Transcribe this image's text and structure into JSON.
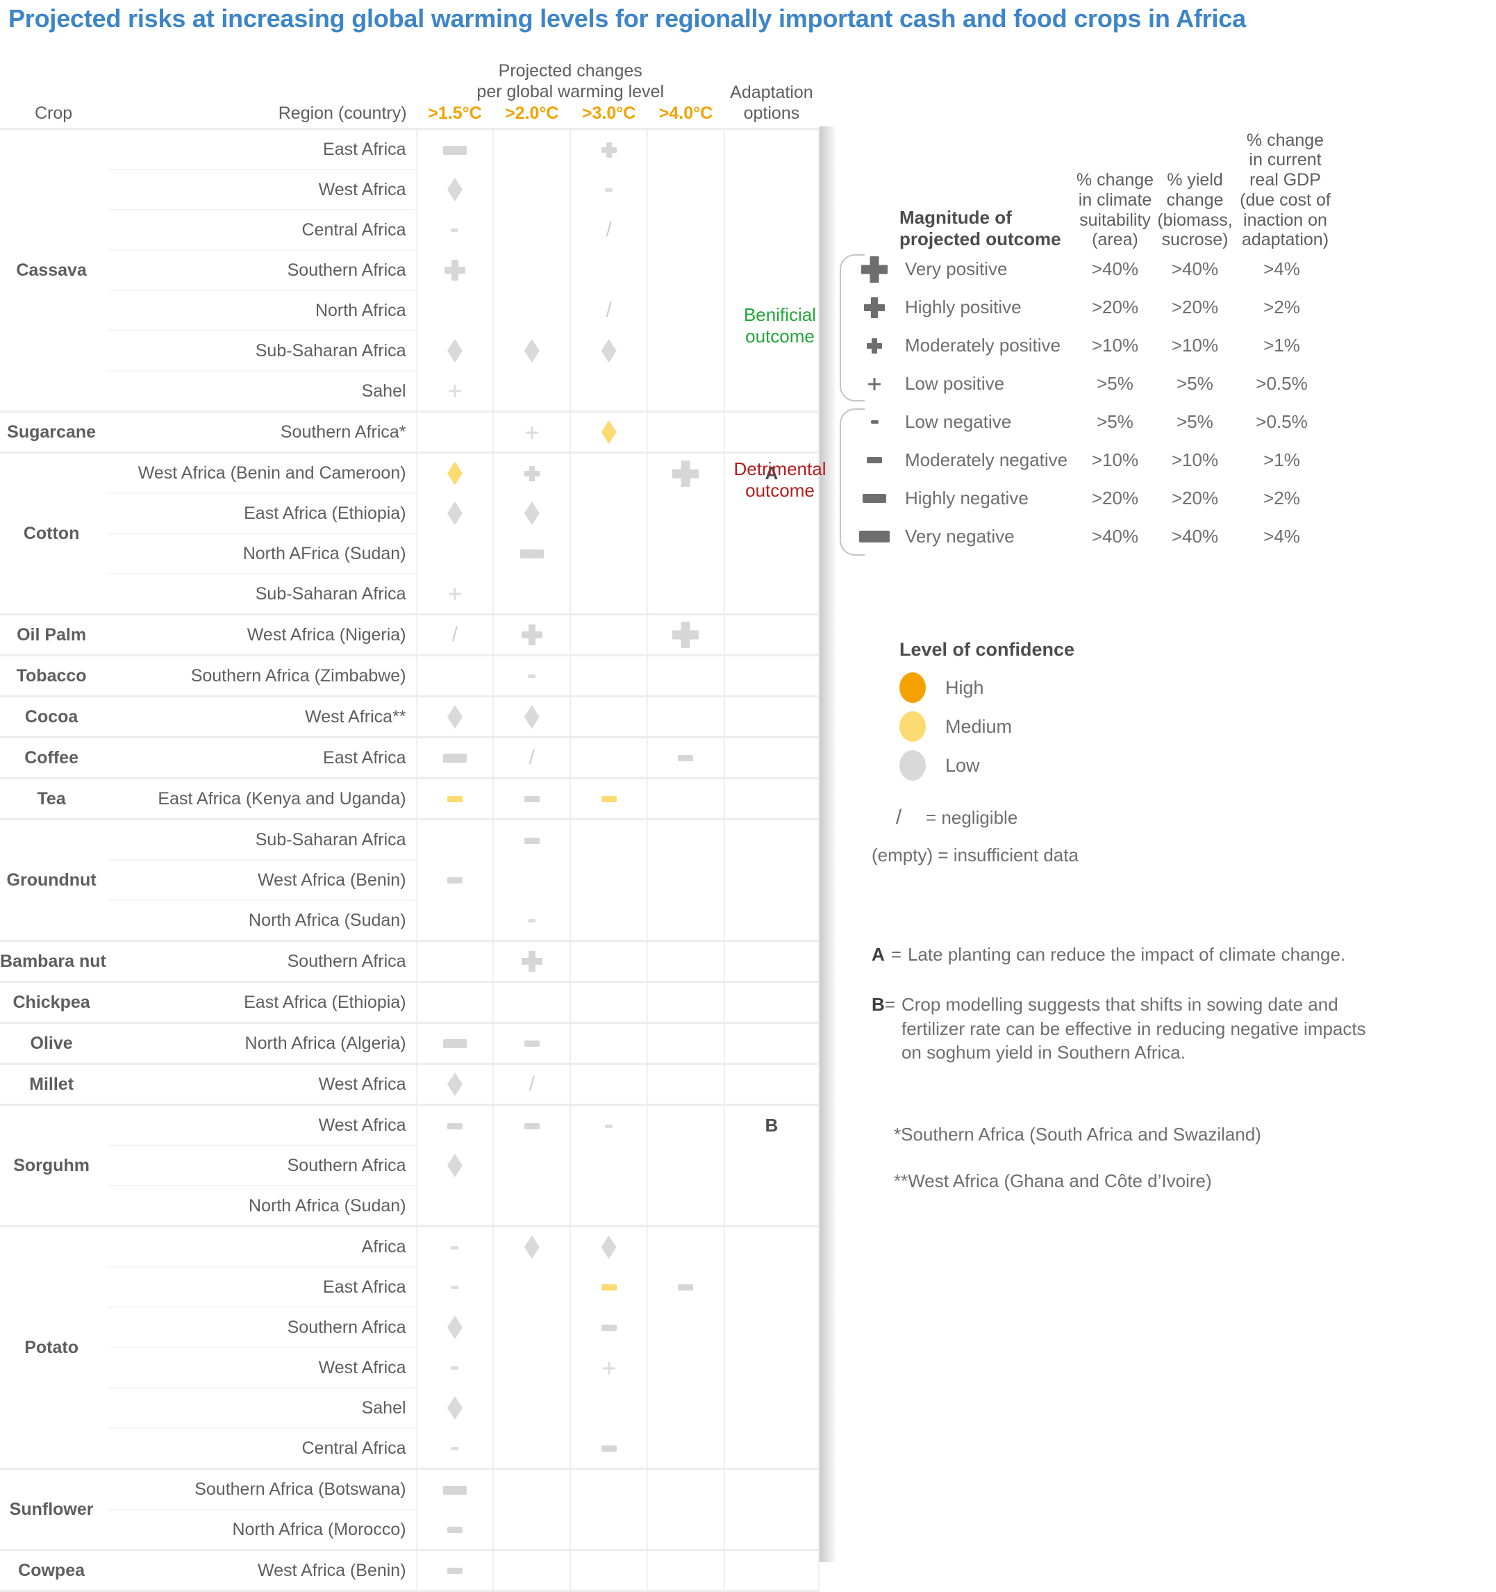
{
  "title": "Projected risks at increasing global warming levels for regionally important cash and food crops in Africa",
  "table": {
    "span_header_line1": "Projected changes",
    "span_header_line2": "per global warming level",
    "headers": {
      "crop": "Crop",
      "region": "Region (country)",
      "gwl": [
        "&gt;1.5°C",
        "&gt;2.0°C",
        "&gt;3.0°C",
        "&gt;4.0°C"
      ],
      "adaptation_line1": "Adaptation",
      "adaptation_line2": "options"
    },
    "groups": [
      {
        "crop": "Cassava",
        "rows": [
          {
            "region": "East Africa",
            "cells": [
              "highly-negative",
              "",
              "moderately-positive",
              ""
            ],
            "conf": [
              "low",
              "",
              "low",
              ""
            ],
            "adapt": ""
          },
          {
            "region": "West Africa",
            "cells": [
              "diamond",
              "",
              "low-negative",
              ""
            ],
            "conf": [
              "low",
              "",
              "low",
              ""
            ],
            "adapt": ""
          },
          {
            "region": "Central Africa",
            "cells": [
              "low-negative",
              "",
              "negligible",
              ""
            ],
            "conf": [
              "low",
              "",
              "low",
              ""
            ],
            "adapt": ""
          },
          {
            "region": "Southern Africa",
            "cells": [
              "highly-positive",
              "",
              "",
              ""
            ],
            "conf": [
              "low",
              "",
              "",
              ""
            ],
            "adapt": ""
          },
          {
            "region": "North Africa",
            "cells": [
              "",
              "",
              "negligible",
              ""
            ],
            "conf": [
              "",
              "",
              "low",
              ""
            ],
            "adapt": ""
          },
          {
            "region": "Sub-Saharan Africa",
            "cells": [
              "diamond",
              "diamond",
              "diamond",
              ""
            ],
            "conf": [
              "low",
              "low",
              "low",
              ""
            ],
            "adapt": ""
          },
          {
            "region": "Sahel",
            "cells": [
              "low-positive",
              "",
              "",
              ""
            ],
            "conf": [
              "low",
              "",
              "",
              ""
            ],
            "adapt": ""
          }
        ]
      },
      {
        "crop": "Sugarcane",
        "rows": [
          {
            "region": "Southern Africa*",
            "cells": [
              "",
              "low-positive",
              "diamond",
              ""
            ],
            "conf": [
              "",
              "low",
              "medium",
              ""
            ],
            "adapt": ""
          }
        ]
      },
      {
        "crop": "Cotton",
        "rows": [
          {
            "region": "West Africa (Benin and Cameroon)",
            "cells": [
              "diamond",
              "moderately-positive",
              "",
              "very-positive"
            ],
            "conf": [
              "medium",
              "low",
              "",
              "low"
            ],
            "adapt": "A"
          },
          {
            "region": "East Africa (Ethiopia)",
            "cells": [
              "diamond",
              "diamond",
              "",
              ""
            ],
            "conf": [
              "low",
              "low",
              "",
              ""
            ],
            "adapt": ""
          },
          {
            "region": "North AFrica (Sudan)",
            "cells": [
              "",
              "highly-negative",
              "",
              ""
            ],
            "conf": [
              "",
              "low",
              "",
              ""
            ],
            "adapt": ""
          },
          {
            "region": "Sub-Saharan Africa",
            "cells": [
              "low-positive",
              "",
              "",
              ""
            ],
            "conf": [
              "low",
              "",
              "",
              ""
            ],
            "adapt": ""
          }
        ]
      },
      {
        "crop": "Oil Palm",
        "rows": [
          {
            "region": "West Africa (Nigeria)",
            "cells": [
              "negligible",
              "highly-positive",
              "",
              "very-positive"
            ],
            "conf": [
              "low",
              "low",
              "",
              "low"
            ],
            "adapt": ""
          }
        ]
      },
      {
        "crop": "Tobacco",
        "rows": [
          {
            "region": "Southern Africa (Zimbabwe)",
            "cells": [
              "",
              "low-negative",
              "",
              ""
            ],
            "conf": [
              "",
              "low",
              "",
              ""
            ],
            "adapt": ""
          }
        ]
      },
      {
        "crop": "Cocoa",
        "rows": [
          {
            "region": "West Africa**",
            "cells": [
              "diamond",
              "diamond",
              "",
              ""
            ],
            "conf": [
              "low",
              "low",
              "",
              ""
            ],
            "adapt": ""
          }
        ]
      },
      {
        "crop": "Coffee",
        "rows": [
          {
            "region": "East Africa",
            "cells": [
              "highly-negative",
              "negligible",
              "",
              "moderately-negative"
            ],
            "conf": [
              "low",
              "low",
              "",
              "low"
            ],
            "adapt": ""
          }
        ]
      },
      {
        "crop": "Tea",
        "rows": [
          {
            "region": "East Africa (Kenya and Uganda)",
            "cells": [
              "moderately-negative",
              "moderately-negative",
              "moderately-negative",
              ""
            ],
            "conf": [
              "medium",
              "low",
              "medium",
              ""
            ],
            "adapt": ""
          }
        ]
      },
      {
        "crop": "Groundnut",
        "rows": [
          {
            "region": "Sub-Saharan Africa",
            "cells": [
              "",
              "moderately-negative",
              "",
              ""
            ],
            "conf": [
              "",
              "low",
              "",
              ""
            ],
            "adapt": ""
          },
          {
            "region": "West Africa (Benin)",
            "cells": [
              "moderately-negative",
              "",
              "",
              ""
            ],
            "conf": [
              "low",
              "",
              "",
              ""
            ],
            "adapt": ""
          },
          {
            "region": "North Africa (Sudan)",
            "cells": [
              "",
              "low-negative",
              "",
              ""
            ],
            "conf": [
              "",
              "low",
              "",
              ""
            ],
            "adapt": ""
          }
        ]
      },
      {
        "crop": "Bambara nut",
        "rows": [
          {
            "region": "Southern Africa",
            "cells": [
              "",
              "highly-positive",
              "",
              ""
            ],
            "conf": [
              "",
              "low",
              "",
              ""
            ],
            "adapt": ""
          }
        ]
      },
      {
        "crop": "Chickpea",
        "rows": [
          {
            "region": "East Africa (Ethiopia)",
            "cells": [
              "",
              "",
              "",
              ""
            ],
            "conf": [
              "",
              "",
              "",
              ""
            ],
            "adapt": ""
          }
        ]
      },
      {
        "crop": "Olive",
        "rows": [
          {
            "region": "North Africa (Algeria)",
            "cells": [
              "highly-negative",
              "moderately-negative",
              "",
              ""
            ],
            "conf": [
              "low",
              "low",
              "",
              ""
            ],
            "adapt": ""
          }
        ]
      },
      {
        "crop": "Millet",
        "rows": [
          {
            "region": "West Africa",
            "cells": [
              "diamond",
              "negligible",
              "",
              ""
            ],
            "conf": [
              "low",
              "low",
              "",
              ""
            ],
            "adapt": ""
          }
        ]
      },
      {
        "crop": "Sorguhm",
        "rows": [
          {
            "region": "West Africa",
            "cells": [
              "moderately-negative",
              "moderately-negative",
              "low-negative",
              ""
            ],
            "conf": [
              "low",
              "low",
              "low",
              ""
            ],
            "adapt": "B"
          },
          {
            "region": "Southern Africa",
            "cells": [
              "diamond",
              "",
              "",
              ""
            ],
            "conf": [
              "low",
              "",
              "",
              ""
            ],
            "adapt": ""
          },
          {
            "region": "North Africa (Sudan)",
            "cells": [
              "",
              "",
              "",
              ""
            ],
            "conf": [
              "",
              "",
              "",
              ""
            ],
            "adapt": ""
          }
        ]
      },
      {
        "crop": "Potato",
        "rows": [
          {
            "region": "Africa",
            "cells": [
              "low-negative",
              "diamond",
              "diamond",
              ""
            ],
            "conf": [
              "low",
              "low",
              "low",
              ""
            ],
            "adapt": ""
          },
          {
            "region": "East Africa",
            "cells": [
              "low-negative",
              "",
              "moderately-negative",
              "moderately-negative"
            ],
            "conf": [
              "low",
              "",
              "medium",
              "low"
            ],
            "adapt": ""
          },
          {
            "region": "Southern Africa",
            "cells": [
              "diamond",
              "",
              "moderately-negative",
              ""
            ],
            "conf": [
              "low",
              "",
              "low",
              ""
            ],
            "adapt": ""
          },
          {
            "region": "West Africa",
            "cells": [
              "low-negative",
              "",
              "low-positive",
              ""
            ],
            "conf": [
              "low",
              "",
              "low",
              ""
            ],
            "adapt": ""
          },
          {
            "region": "Sahel",
            "cells": [
              "diamond",
              "",
              "",
              ""
            ],
            "conf": [
              "low",
              "",
              "",
              ""
            ],
            "adapt": ""
          },
          {
            "region": "Central Africa",
            "cells": [
              "low-negative",
              "",
              "moderately-negative",
              ""
            ],
            "conf": [
              "low",
              "",
              "low",
              ""
            ],
            "adapt": ""
          }
        ]
      },
      {
        "crop": "Sunflower",
        "rows": [
          {
            "region": "Southern Africa (Botswana)",
            "cells": [
              "highly-negative",
              "",
              "",
              ""
            ],
            "conf": [
              "low",
              "",
              "",
              ""
            ],
            "adapt": ""
          },
          {
            "region": "North Africa (Morocco)",
            "cells": [
              "moderately-negative",
              "",
              "",
              ""
            ],
            "conf": [
              "low",
              "",
              "",
              ""
            ],
            "adapt": ""
          }
        ]
      },
      {
        "crop": "Cowpea",
        "rows": [
          {
            "region": "West Africa (Benin)",
            "cells": [
              "moderately-negative",
              "",
              "",
              ""
            ],
            "conf": [
              "low",
              "",
              "",
              ""
            ],
            "adapt": ""
          }
        ]
      }
    ]
  },
  "legend": {
    "magnitude_title_line1": "Magnitude of",
    "magnitude_title_line2": "projected outcome",
    "col1": [
      "% change",
      "in climate",
      "suitability",
      "(area)"
    ],
    "col2": [
      "% yield",
      "change",
      "(biomass,",
      "sucrose)"
    ],
    "col3": [
      "% change",
      "in current",
      "real GDP",
      "(due cost of",
      "inaction on",
      "adaptation)"
    ],
    "beneficial_line1": "Benificial",
    "beneficial_line2": "outcome",
    "detrimental_line1": "Detrimental",
    "detrimental_line2": "outcome",
    "rows": [
      {
        "sym": "very-positive",
        "label": "Very positive",
        "v1": "&gt;40%",
        "v2": "&gt;40%",
        "v3": "&gt;4%"
      },
      {
        "sym": "highly-positive",
        "label": "Highly positive",
        "v1": "&gt;20%",
        "v2": "&gt;20%",
        "v3": "&gt;2%"
      },
      {
        "sym": "moderately-positive",
        "label": "Moderately positive",
        "v1": "&gt;10%",
        "v2": "&gt;10%",
        "v3": "&gt;1%"
      },
      {
        "sym": "low-positive",
        "label": "Low positive",
        "v1": "&gt;5%",
        "v2": "&gt;5%",
        "v3": "&gt;0.5%"
      },
      {
        "sym": "low-negative",
        "label": "Low negative",
        "v1": "&gt;5%",
        "v2": "&gt;5%",
        "v3": "&gt;0.5%"
      },
      {
        "sym": "moderately-negative",
        "label": "Moderately negative",
        "v1": "&gt;10%",
        "v2": "&gt;10%",
        "v3": "&gt;1%"
      },
      {
        "sym": "highly-negative",
        "label": "Highly negative",
        "v1": "&gt;20%",
        "v2": "&gt;20%",
        "v3": "&gt;2%"
      },
      {
        "sym": "very-negative",
        "label": "Very negative",
        "v1": "&gt;40%",
        "v2": "&gt;40%",
        "v3": "&gt;4%"
      }
    ],
    "confidence_title": "Level of confidence",
    "confidence": [
      {
        "label": "High",
        "color": "#f5a200"
      },
      {
        "label": "Medium",
        "color": "#fcdb72"
      },
      {
        "label": "Low",
        "color": "#d9d9d9"
      }
    ],
    "negligible_sym": "/",
    "negligible_note": "= negligible",
    "empty_note": "(empty) = insufficient data",
    "footnotes": [
      {
        "key": "A",
        "sep": "=",
        "text": "Late planting can reduce the impact of climate change."
      },
      {
        "key": "B",
        "sep": "=",
        "text": "Crop modelling suggests that shifts in sowing date and fertilizer rate can be effective in reducing negative impacts on soghum yield in Southern Africa."
      }
    ],
    "star_notes": [
      "*Southern Africa (South Africa and Swaziland)",
      "**West Africa (Ghana and Côte d’Ivoire)"
    ]
  },
  "colors": {
    "title": "#3d85c8",
    "gwl_header": "#f5a200",
    "beneficial": "#22a63a",
    "detrimental": "#b71d1d",
    "symbol_grey": "#d6d6d6",
    "confidence_high": "#f5a200",
    "confidence_medium": "#fcdb72",
    "confidence_low": "#d9d9d9"
  }
}
